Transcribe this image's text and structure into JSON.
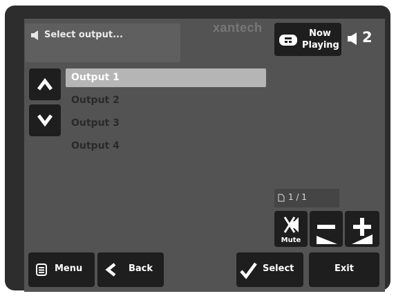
{
  "status": {
    "text": "Select output..."
  },
  "brand": {
    "logo_text": "xantech"
  },
  "now_playing": {
    "label_line1": "Now",
    "label_line2": "Playing"
  },
  "volume": {
    "zone_number": "2"
  },
  "outputs": [
    {
      "label": "Output 1",
      "selected": true
    },
    {
      "label": "Output 2",
      "selected": false
    },
    {
      "label": "Output 3",
      "selected": false
    },
    {
      "label": "Output 4",
      "selected": false
    }
  ],
  "pagination": {
    "text": "1 / 1"
  },
  "controls": {
    "mute_label": "Mute"
  },
  "bottom_bar": {
    "menu_label": "Menu",
    "back_label": "Back",
    "select_label": "Select",
    "exit_label": "Exit"
  },
  "icons": {
    "status": "speaker-icon",
    "now_playing": "disc-player-icon",
    "volume": "speaker-icon",
    "up": "chevron-up-icon",
    "down": "chevron-down-icon",
    "page": "page-icon",
    "mute": "mute-icon",
    "menu": "list-icon",
    "back": "chevron-left-icon",
    "select": "checkmark-icon"
  },
  "colors": {
    "screen": "#535353",
    "bezel": "#2d2d2d",
    "button": "#1e1e1e",
    "selected_row": "#b5b5b5",
    "text_light": "#ffffff"
  }
}
